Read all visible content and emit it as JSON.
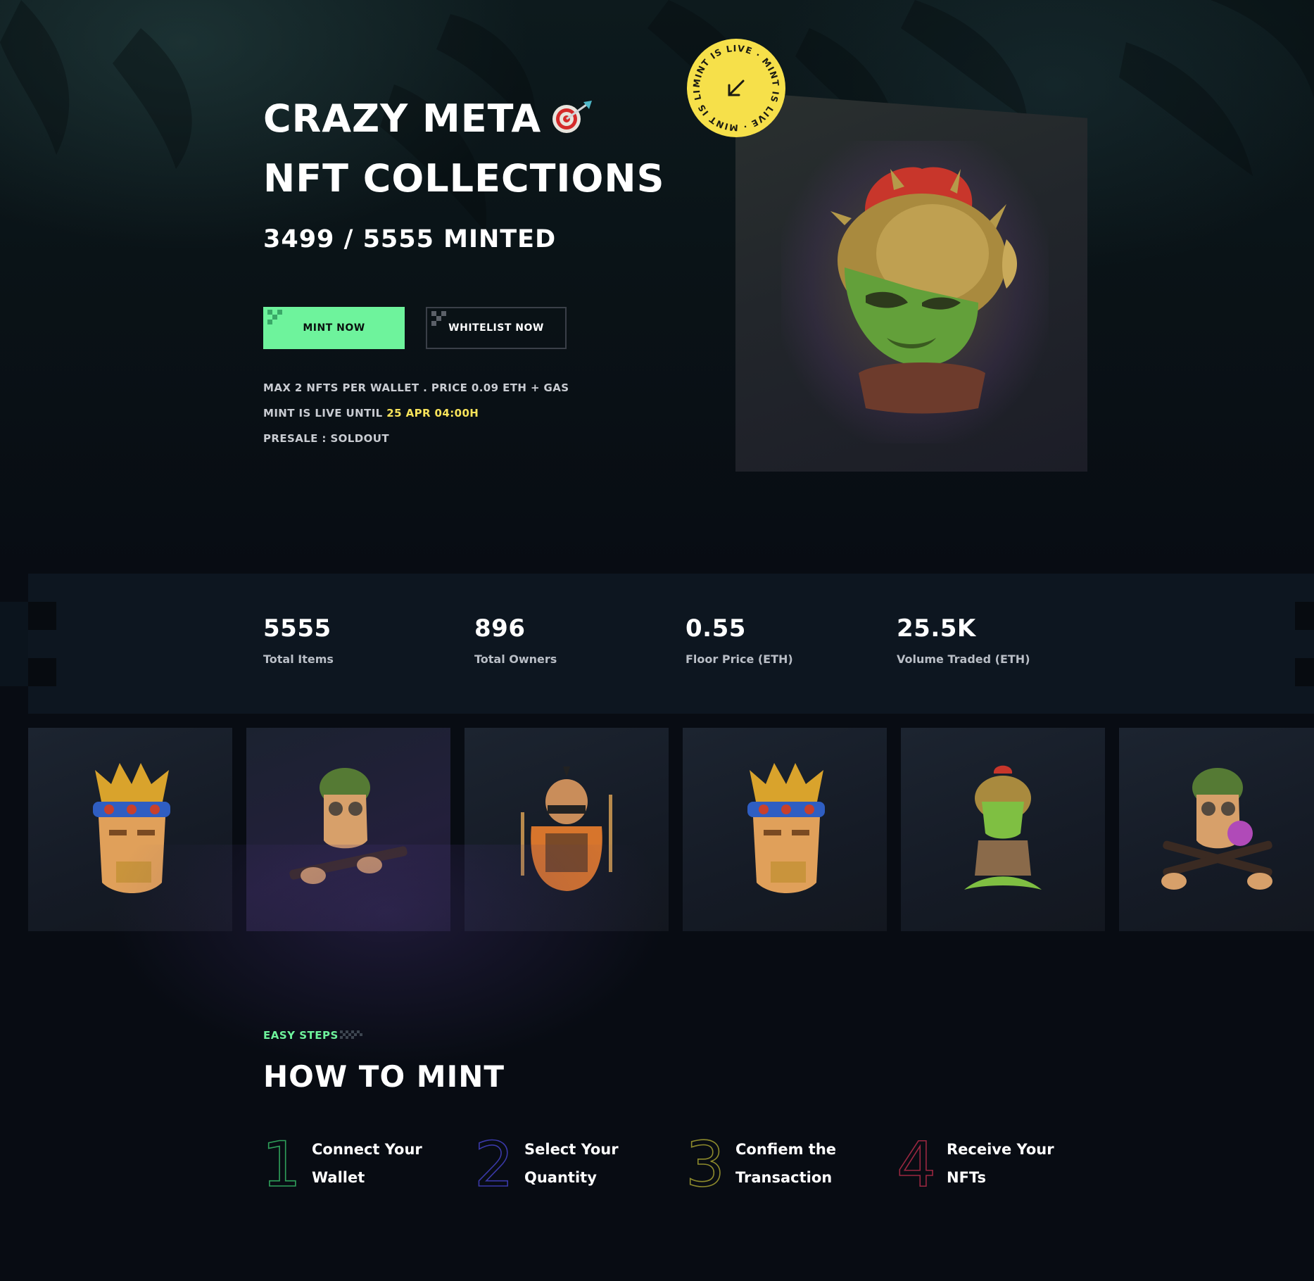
{
  "hero": {
    "title_line1": "CRAZY META",
    "title_line2": "NFT COLLECTIONS",
    "minted": "3499 / 5555 MINTED",
    "mint_button": "MINT NOW",
    "whitelist_button": "WHITELIST NOW",
    "info_line1": "MAX 2 NFTS PER WALLET  .  PRICE 0.09 ETH + GAS",
    "info_line2_prefix": "MINT IS LIVE UNTIL ",
    "info_line2_highlight": "25 APR 04:00H",
    "info_line3": "PRESALE : SOLDOUT",
    "badge_text": "MINT IS LIVE · MINT IS LIVE · MINT IS LIVE ·",
    "badge_icon": "arrow-down-left-icon",
    "title_icon": "target-dart-icon",
    "hero_image": "goblin-gladiator-nft"
  },
  "stats": [
    {
      "value": "5555",
      "label": "Total Items"
    },
    {
      "value": "896",
      "label": "Total Owners"
    },
    {
      "value": "0.55",
      "label": "Floor Price (ETH)"
    },
    {
      "value": "25.5K",
      "label": "Volume Traded (ETH)"
    }
  ],
  "gallery": [
    {
      "image": "king-crown-nft"
    },
    {
      "image": "soldier-rifle-nft"
    },
    {
      "image": "samurai-warrior-nft"
    },
    {
      "image": "king-crown-nft"
    },
    {
      "image": "goblin-crossed-legs-nft"
    },
    {
      "image": "soldier-bubblegum-nft"
    }
  ],
  "how_to": {
    "eyebrow": "EASY STEPS",
    "title": "HOW TO MINT",
    "steps": [
      {
        "number": "1",
        "line1": "Connect Your",
        "line2": "Wallet",
        "color": "#2fa05a"
      },
      {
        "number": "2",
        "line1": "Select Your",
        "line2": "Quantity",
        "color": "#3a39a8"
      },
      {
        "number": "3",
        "line1": "Confiem the",
        "line2": "Transaction",
        "color": "#8d8a2c"
      },
      {
        "number": "4",
        "line1": "Receive Your",
        "line2": "NFTs",
        "color": "#9a2740"
      }
    ]
  },
  "colors": {
    "accent_green": "#6ef39c",
    "highlight_yellow": "#f7e35a",
    "badge_yellow": "#f6e04a",
    "background": "#080c13"
  }
}
